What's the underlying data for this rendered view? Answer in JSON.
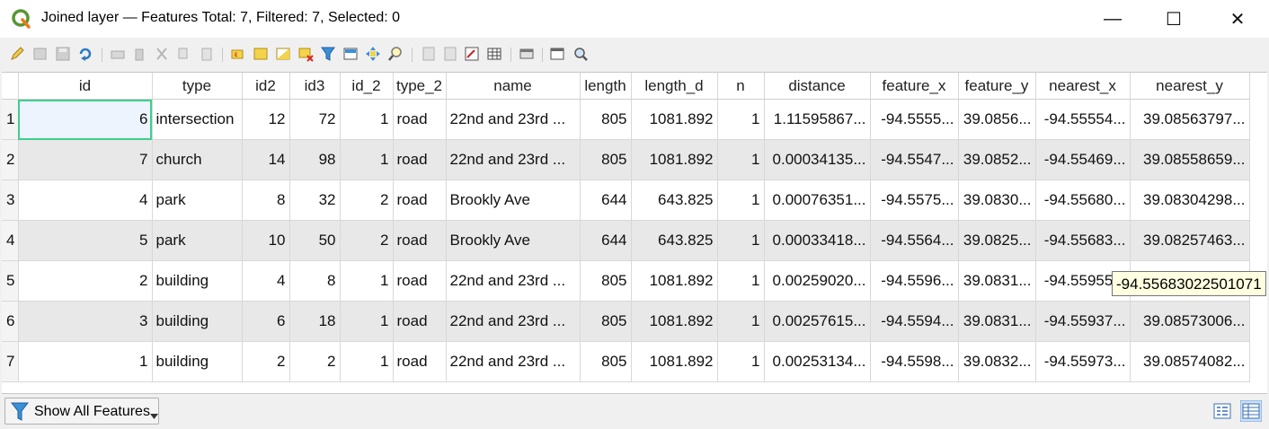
{
  "window": {
    "title": "Joined layer — Features Total: 7, Filtered: 7, Selected: 0",
    "minimize": "—",
    "maximize": "☐",
    "close": "✕"
  },
  "table": {
    "columns": [
      "id",
      "type",
      "id2",
      "id3",
      "id_2",
      "type_2",
      "name",
      "length",
      "length_d",
      "n",
      "distance",
      "feature_x",
      "feature_y",
      "nearest_x",
      "nearest_y"
    ],
    "rows": [
      [
        "1",
        "6",
        "intersection",
        "12",
        "72",
        "1",
        "road",
        "22nd and 23rd ...",
        "805",
        "1081.892",
        "1",
        "1.11595867...",
        "-94.5555...",
        "39.0856...",
        "-94.55554...",
        "39.08563797..."
      ],
      [
        "2",
        "7",
        "church",
        "14",
        "98",
        "1",
        "road",
        "22nd and 23rd ...",
        "805",
        "1081.892",
        "1",
        "0.00034135...",
        "-94.5547...",
        "39.0852...",
        "-94.55469...",
        "39.08558659..."
      ],
      [
        "3",
        "4",
        "park",
        "8",
        "32",
        "2",
        "road",
        "Brookly Ave",
        "644",
        "643.825",
        "1",
        "0.00076351...",
        "-94.5575...",
        "39.0830...",
        "-94.55680...",
        "39.08304298..."
      ],
      [
        "4",
        "5",
        "park",
        "10",
        "50",
        "2",
        "road",
        "Brookly Ave",
        "644",
        "643.825",
        "1",
        "0.00033418...",
        "-94.5564...",
        "39.0825...",
        "-94.55683...",
        "39.08257463..."
      ],
      [
        "5",
        "2",
        "building",
        "4",
        "8",
        "1",
        "road",
        "22nd and 23rd ...",
        "805",
        "1081.892",
        "1",
        "0.00259020...",
        "-94.5596...",
        "39.0831...",
        "-94.55955...",
        ""
      ],
      [
        "6",
        "3",
        "building",
        "6",
        "18",
        "1",
        "road",
        "22nd and 23rd ...",
        "805",
        "1081.892",
        "1",
        "0.00257615...",
        "-94.5594...",
        "39.0831...",
        "-94.55937...",
        "39.08573006..."
      ],
      [
        "7",
        "1",
        "building",
        "2",
        "2",
        "1",
        "road",
        "22nd and 23rd ...",
        "805",
        "1081.892",
        "1",
        "0.00253134...",
        "-94.5598...",
        "39.0832...",
        "-94.55973...",
        "39.08574082..."
      ]
    ]
  },
  "tooltip": "-94.55683022501071",
  "footer": {
    "filter_label": "Show All Features"
  },
  "colors": {
    "selection_outline": "#3bd08c",
    "alt_row": "#e8e8e8",
    "tooltip_bg": "#ffffe1"
  },
  "icons": {
    "toolbar": [
      "toggle-editing-icon",
      "multi-edit-icon",
      "save-edits-icon",
      "reload-icon",
      "add-feature-icon",
      "delete-feature-icon",
      "cut-icon",
      "copy-icon",
      "paste-icon",
      "expression-select-icon",
      "select-all-icon",
      "invert-selection-icon",
      "deselect-all-icon",
      "filter-selection-icon",
      "move-selection-top-icon",
      "pan-to-selection-icon",
      "zoom-to-selection-icon",
      "new-field-icon",
      "delete-field-icon",
      "field-calculator-icon",
      "conditional-formatting-icon",
      "dock-table-icon",
      "actions-icon",
      "zoom-map-icon"
    ]
  }
}
